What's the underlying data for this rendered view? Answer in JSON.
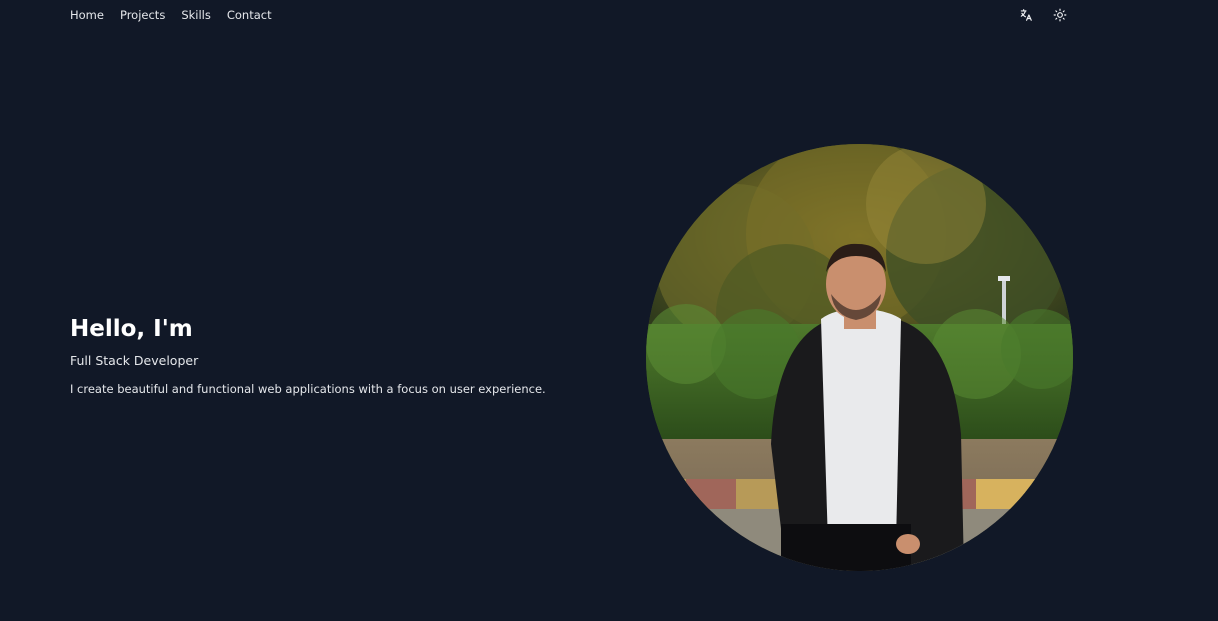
{
  "nav": {
    "items": [
      {
        "label": "Home"
      },
      {
        "label": "Projects"
      },
      {
        "label": "Skills"
      },
      {
        "label": "Contact"
      }
    ],
    "actions": {
      "translate_icon": "translate-icon",
      "theme_icon": "sun-icon"
    }
  },
  "hero": {
    "greeting": "Hello, I'm",
    "role": "Full Stack Developer",
    "description": "I create beautiful and functional web applications with a focus on user experience."
  },
  "colors": {
    "background": "#111827",
    "text": "#f3f4f6"
  }
}
